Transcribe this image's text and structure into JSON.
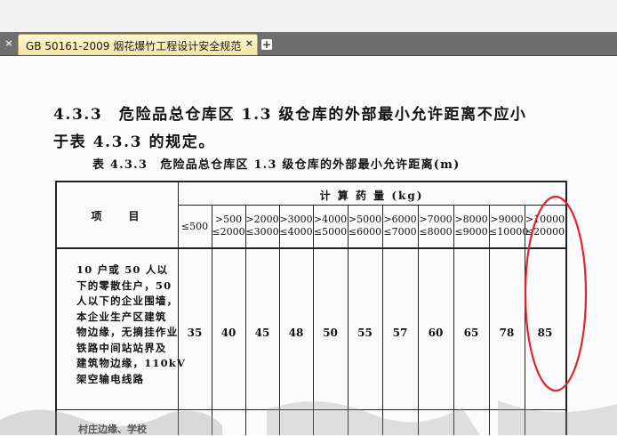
{
  "tabs": {
    "active_title": "GB 50161-2009 烟花爆竹工程设计安全规范",
    "close_glyph": "×",
    "add_glyph": "+"
  },
  "document": {
    "heading_line1": "4.3.3　危险品总仓库区 1.3 级仓库的外部最小允许距离不应小",
    "heading_line2": "于表 4.3.3 的规定。",
    "table_caption": "表 4.3.3　危险品总仓库区 1.3 级仓库的外部最小允许距离(m)",
    "table": {
      "item_header": "项　　目",
      "group_header": "计 算 药 量 (kg)",
      "ranges": [
        [
          "≤500"
        ],
        [
          ">500",
          "≤2000"
        ],
        [
          ">2000",
          "≤3000"
        ],
        [
          ">3000",
          "≤4000"
        ],
        [
          ">4000",
          "≤5000"
        ],
        [
          ">5000",
          "≤6000"
        ],
        [
          ">6000",
          "≤7000"
        ],
        [
          ">7000",
          "≤8000"
        ],
        [
          ">8000",
          "≤9000"
        ],
        [
          ">9000",
          "≤10000"
        ],
        [
          ">10000",
          "≤20000"
        ]
      ],
      "row1_desc_lines": [
        "10 户或 50 人以",
        "下的零散住户，50",
        "人以下的企业围墙，",
        "本企业生产区建筑",
        "物边缘，无摘挂作业",
        "铁路中间站站界及",
        "建筑物边缘，110kV",
        "架空输电线路"
      ],
      "row1_values": [
        "35",
        "40",
        "45",
        "48",
        "50",
        "55",
        "57",
        "60",
        "65",
        "78",
        "85"
      ],
      "row2_partial": "村庄边缘、学校"
    }
  },
  "annotation": {
    "color": "#e0252b"
  }
}
